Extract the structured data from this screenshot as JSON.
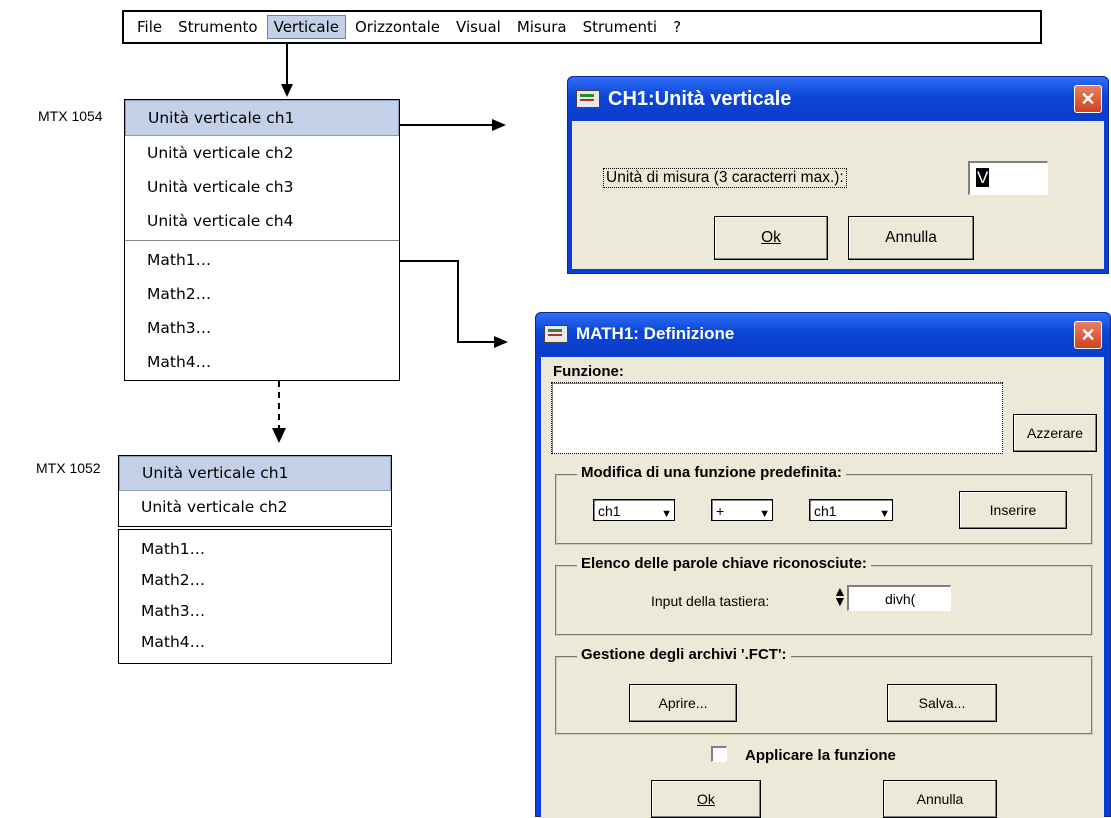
{
  "menubar": {
    "items": [
      "File",
      "Strumento",
      "Verticale",
      "Orizzontale",
      "Visual",
      "Misura",
      "Strumenti",
      "?"
    ]
  },
  "menu_1054": {
    "model": "MTX 1054",
    "units": [
      "Unità verticale ch1",
      "Unità verticale ch2",
      "Unità verticale ch3",
      "Unità verticale ch4"
    ],
    "maths": [
      "Math1…",
      "Math2…",
      "Math3…",
      "Math4…"
    ]
  },
  "menu_1052": {
    "model": "MTX 1052",
    "units": [
      "Unità verticale ch1",
      "Unità verticale ch2"
    ],
    "maths": [
      "Math1…",
      "Math2…",
      "Math3…",
      "Math4…"
    ]
  },
  "ch1_dialog": {
    "title": "CH1:Unità verticale",
    "label": "Unità di misura (3 caracterri max.):",
    "value": "V",
    "ok": "Ok",
    "cancel": "Annulla"
  },
  "math1_dialog": {
    "title": "MATH1: Definizione",
    "funzione_label": "Funzione:",
    "funzione_value": "",
    "reset": "Azzerare",
    "predef_group": "Modifica di una funzione predefinita:",
    "op1": "ch1",
    "op": "+",
    "op2": "ch1",
    "insert": "Inserire",
    "keywords_group": "Elenco delle parole chiave riconosciute:",
    "keyboard_label": "Input della tastiera:",
    "keyboard_value": "divh(",
    "files_group": "Gestione degli archivi '.FCT':",
    "open": "Aprire...",
    "save": "Salva...",
    "apply_label": "Applicare la funzione",
    "ok": "Ok",
    "cancel": "Annulla"
  }
}
